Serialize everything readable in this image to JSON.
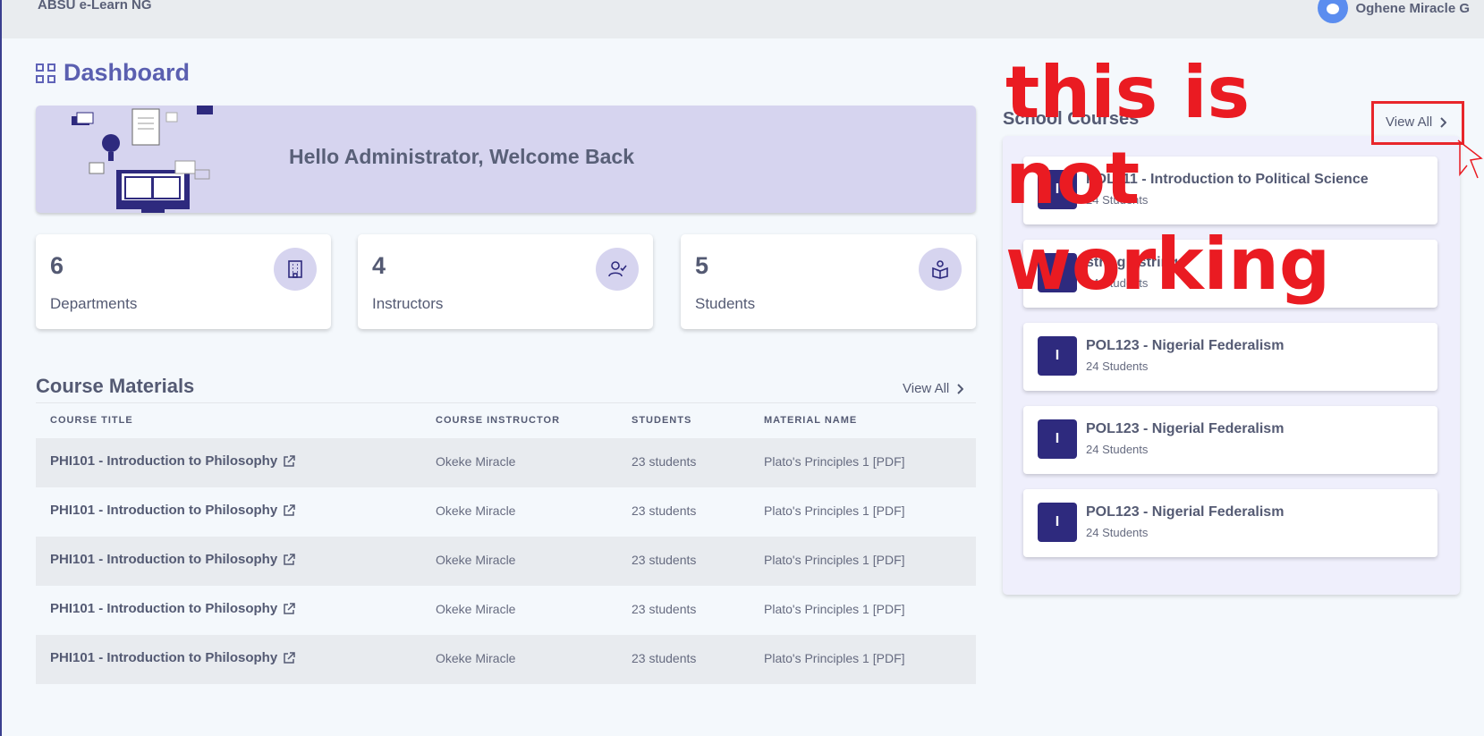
{
  "topbar": {
    "brand": "ABSU e-Learn NG",
    "user_name": "Oghene Miracle G"
  },
  "page": {
    "title": "Dashboard"
  },
  "banner": {
    "greeting": "Hello Administrator, Welcome Back"
  },
  "stats": [
    {
      "value": "6",
      "label": "Departments",
      "icon": "building-icon"
    },
    {
      "value": "4",
      "label": "Instructors",
      "icon": "user-check-icon"
    },
    {
      "value": "5",
      "label": "Students",
      "icon": "reader-icon"
    }
  ],
  "materials": {
    "title": "Course Materials",
    "view_all": "View All",
    "columns": [
      "COURSE TITLE",
      "COURSE INSTRUCTOR",
      "STUDENTS",
      "MATERIAL NAME"
    ],
    "rows": [
      {
        "course": "PHI101 - Introduction to Philosophy",
        "instructor": "Okeke Miracle",
        "students": "23 students",
        "material": "Plato's Principles 1 [PDF]"
      },
      {
        "course": "PHI101 - Introduction to Philosophy",
        "instructor": "Okeke Miracle",
        "students": "23 students",
        "material": "Plato's Principles 1 [PDF]"
      },
      {
        "course": "PHI101 - Introduction to Philosophy",
        "instructor": "Okeke Miracle",
        "students": "23 students",
        "material": "Plato's Principles 1 [PDF]"
      },
      {
        "course": "PHI101 - Introduction to Philosophy",
        "instructor": "Okeke Miracle",
        "students": "23 students",
        "material": "Plato's Principles 1 [PDF]"
      },
      {
        "course": "PHI101 - Introduction to Philosophy",
        "instructor": "Okeke Miracle",
        "students": "23 students",
        "material": "Plato's Principles 1 [PDF]"
      }
    ]
  },
  "school_courses": {
    "title": "School Courses",
    "view_all": "View All",
    "items": [
      {
        "badge": "I",
        "name": "POL111 - Introduction to Political Science",
        "count": "24 Students"
      },
      {
        "badge": "I",
        "name": "string - string",
        "count": "24 Students"
      },
      {
        "badge": "I",
        "name": "POL123 - Nigerial Federalism",
        "count": "24 Students"
      },
      {
        "badge": "I",
        "name": "POL123 - Nigerial Federalism",
        "count": "24 Students"
      },
      {
        "badge": "I",
        "name": "POL123 - Nigerial Federalism",
        "count": "24 Students"
      }
    ]
  },
  "annotation": {
    "text": "this is not working",
    "color": "#ea1b22"
  },
  "colors": {
    "accent": "#5a5fb0",
    "badge": "#2e2a7e",
    "banner": "#d6d4ef"
  }
}
